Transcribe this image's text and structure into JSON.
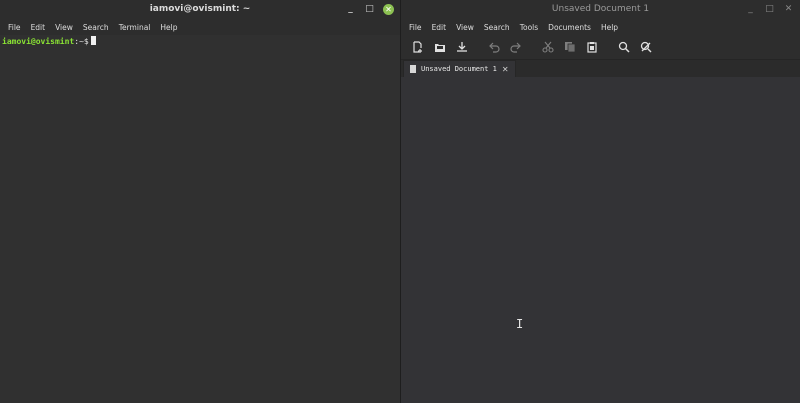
{
  "terminal": {
    "title": "iamovi@ovismint: ~",
    "menu": [
      "File",
      "Edit",
      "View",
      "Search",
      "Terminal",
      "Help"
    ],
    "prompt_user": "iamovi@ovismint",
    "prompt_path": ":~$"
  },
  "editor": {
    "title": "Unsaved Document 1",
    "menu": [
      "File",
      "Edit",
      "View",
      "Search",
      "Tools",
      "Documents",
      "Help"
    ],
    "toolbar_icons": [
      "new-document-icon",
      "open-icon",
      "save-icon",
      "undo-icon",
      "redo-icon",
      "cut-icon",
      "copy-icon",
      "paste-icon",
      "search-icon",
      "replace-icon"
    ],
    "tab_label": "Unsaved Document 1",
    "tab_close": "✕"
  },
  "window_controls": {
    "minimize": "_",
    "maximize": "□",
    "close": "✕"
  },
  "colors": {
    "prompt_green": "#8ae234",
    "close_button_active": "#8cc152"
  }
}
